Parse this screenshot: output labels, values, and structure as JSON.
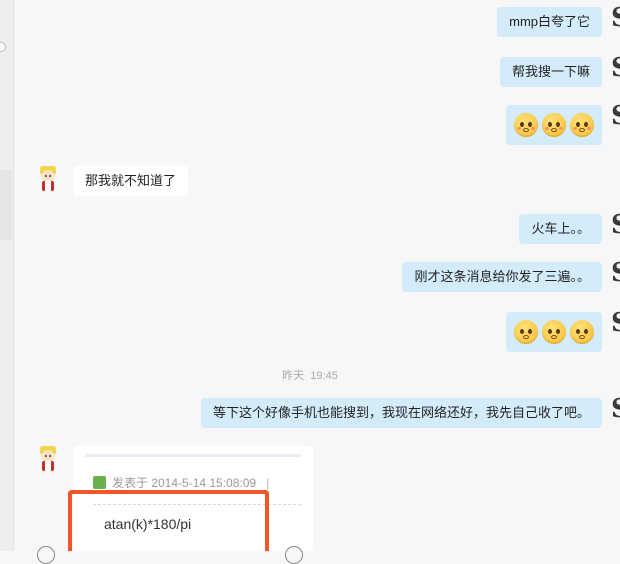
{
  "messages": {
    "m1": {
      "text": "mmp白夸了它"
    },
    "m2": {
      "text": "帮我搜一下嘛"
    },
    "m3": {
      "emojis": [
        "flushed-face-icon",
        "flushed-face-icon",
        "flushed-face-icon"
      ]
    },
    "m4": {
      "text": "那我就不知道了"
    },
    "m5": {
      "text": "火车上。。"
    },
    "m6": {
      "text": "刚才这条消息给你发了三遍。。"
    },
    "m7": {
      "emojis": [
        "smile-face-icon",
        "smile-face-icon",
        "smile-face-icon"
      ]
    },
    "m8": {
      "text": "等下这个好像手机也能搜到，我现在网络还好，我先自己收了吧。"
    }
  },
  "timestamp": {
    "day": "昨天",
    "time": "19:45"
  },
  "shared_card": {
    "meta": "发表于 2014-5-14 15:08:09",
    "meta_sep": "|",
    "formula": "atan(k)*180/pi"
  },
  "colors": {
    "sent_bubble": "#d4ecfa",
    "received_bubble": "#ffffff",
    "highlight_box": "#f0562a",
    "background": "#f7f7f7"
  }
}
